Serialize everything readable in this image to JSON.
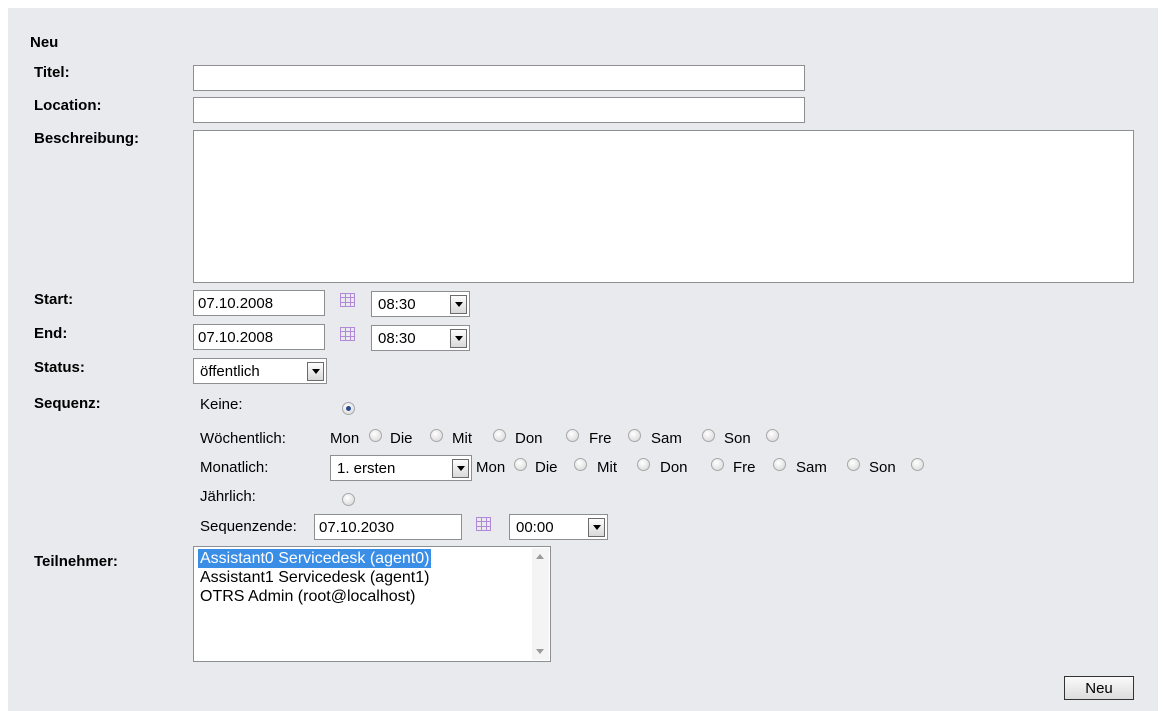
{
  "form": {
    "heading": "Neu",
    "title_label": "Titel:",
    "title_value": "",
    "location_label": "Location:",
    "location_value": "",
    "description_label": "Beschreibung:",
    "description_value": "",
    "start_label": "Start:",
    "start_date": "07.10.2008",
    "start_time": "08:30",
    "end_label": "End:",
    "end_date": "07.10.2008",
    "end_time": "08:30",
    "status_label": "Status:",
    "status_value": "öffentlich",
    "sequence_label": "Sequenz:",
    "participants_label": "Teilnehmer:",
    "submit_label": "Neu"
  },
  "sequence": {
    "none_label": "Keine:",
    "weekly_label": "Wöchentlich:",
    "monthly_label": "Monatlich:",
    "monthly_select": "1. ersten",
    "yearly_label": "Jährlich:",
    "end_label": "Sequenzende:",
    "end_date": "07.10.2030",
    "end_time": "00:00",
    "days": [
      "Mon",
      "Die",
      "Mit",
      "Don",
      "Fre",
      "Sam",
      "Son"
    ]
  },
  "participants": [
    "Assistant0 Servicedesk (agent0)",
    "Assistant1 Servicedesk (agent1)",
    "OTRS Admin (root@localhost)"
  ],
  "icons": {
    "calendar": "calendar-icon",
    "dropdown": "chevron-down-icon"
  },
  "colors": {
    "panel_bg": "#e8eaee",
    "selected_option": "#3a8ee6",
    "calendar_icon": "#b08ad6"
  }
}
